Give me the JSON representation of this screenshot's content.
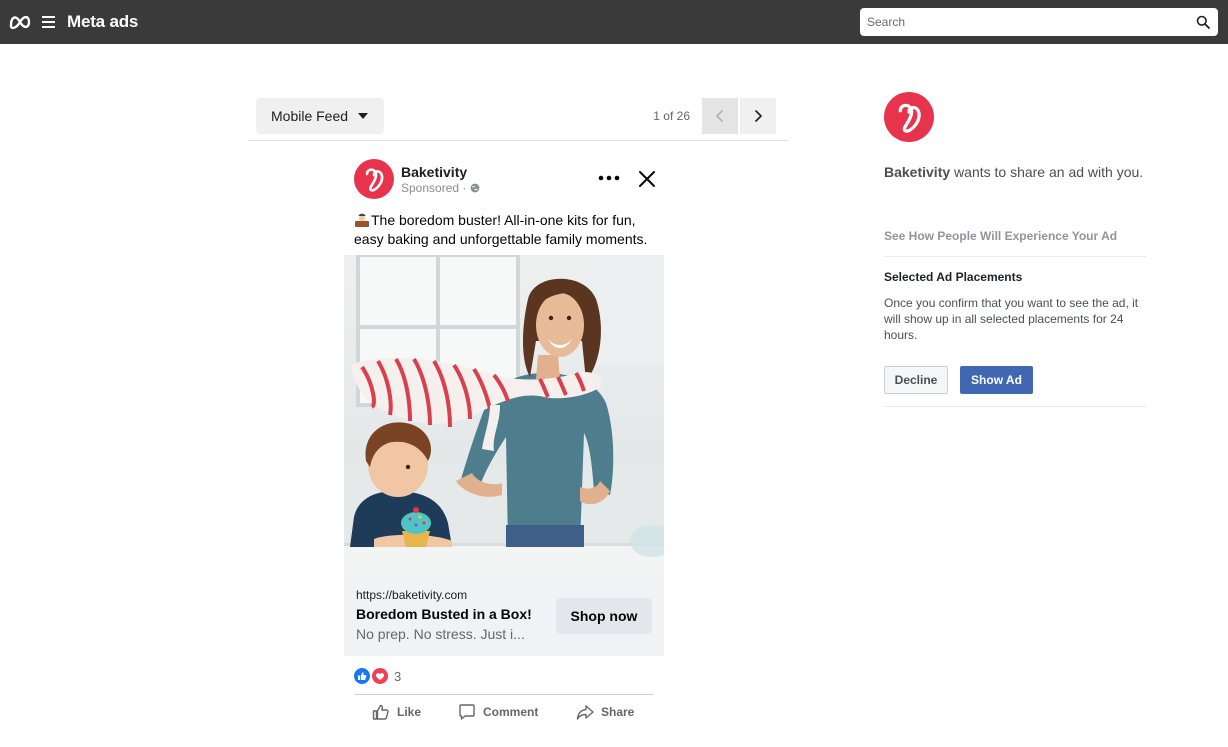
{
  "topbar": {
    "brand": "Meta ads",
    "search_placeholder": "Search"
  },
  "preview": {
    "placement": "Mobile Feed",
    "page_count": "1 of 26"
  },
  "ad": {
    "advertiser": "Baketivity",
    "sponsored": "Sponsored · ",
    "primary_text": "The boredom buster! All-in-one kits for fun, easy baking and unforgettable family moments.",
    "link_url": "https://baketivity.com",
    "headline": "Boredom Busted in a Box!",
    "description": "No prep. No stress. Just i...",
    "cta_label": "Shop now",
    "reaction_count": "3",
    "actions": {
      "like": "Like",
      "comment": "Comment",
      "share": "Share"
    }
  },
  "panel": {
    "advertiser": "Baketivity",
    "share_message": " wants to share an ad with you.",
    "see_how": "See How People Will Experience Your Ad",
    "selected_title": "Selected Ad Placements",
    "selected_desc": "Once you confirm that you want to see the ad, it will show up in all selected placements for 24 hours.",
    "decline_label": "Decline",
    "show_label": "Show Ad"
  },
  "colors": {
    "topbar": "#3a3a3a",
    "brand_red": "#e8334d",
    "show_button": "#4267b2"
  }
}
